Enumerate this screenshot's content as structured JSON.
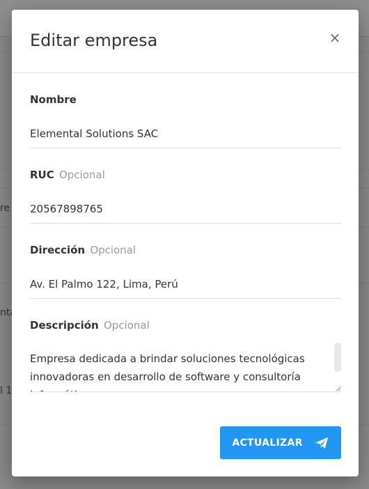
{
  "background": {
    "fragments": [
      "re",
      "nta",
      "l 1"
    ]
  },
  "modal": {
    "title": "Editar empresa",
    "close_symbol": "×",
    "fields": {
      "name": {
        "label": "Nombre",
        "value": "Elemental Solutions SAC"
      },
      "ruc": {
        "label": "RUC",
        "optional": "Opcional",
        "value": "20567898765"
      },
      "address": {
        "label": "Dirección",
        "optional": "Opcional",
        "value": "Av. El Palmo 122, Lima, Perú"
      },
      "description": {
        "label": "Descripción",
        "optional": "Opcional",
        "value": "Empresa dedicada a brindar soluciones tecnológicas innovadoras en desarrollo de software y consultoría informática"
      }
    },
    "submit_label": "ACTUALIZAR"
  },
  "colors": {
    "primary": "#2196f3",
    "overlay": "#8a8a8a"
  },
  "icons": {
    "close": "close-icon",
    "submit": "send-icon"
  }
}
